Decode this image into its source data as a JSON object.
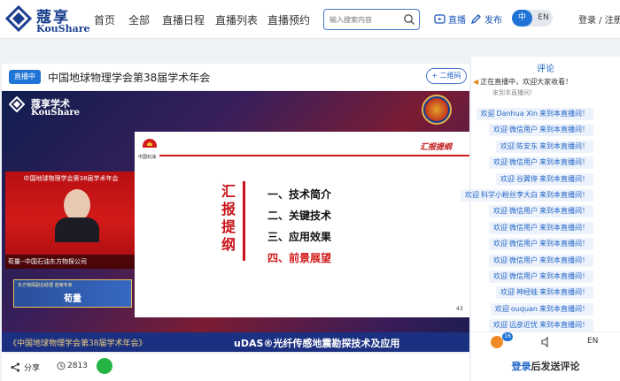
{
  "header": {
    "logo_cn": "蔻享",
    "logo_en": "KouShare",
    "nav": [
      "首页",
      "全部",
      "直播日程",
      "直播列表",
      "直播预约"
    ],
    "search_placeholder": "输入搜索内容",
    "live_btn": "直播",
    "publish_btn": "发布",
    "lang_zh": "中",
    "lang_en": "EN",
    "login": "登录 / 注册"
  },
  "live": {
    "badge": "直播中",
    "title": "中国地球物理学会第38届学术年会",
    "qr_label": "+ 二维码"
  },
  "video": {
    "logo_cn": "蔻享学术",
    "logo_en": "KouShare",
    "cam_header": "中国地球物理学会第38届学术年会",
    "cam_label": "荀量--中国石油东方物探公司",
    "namecard_small": "东方物探副总经理 首席专家",
    "namecard_name": "荀量",
    "slide_brand": "中国石油",
    "slide_section": "汇报提纲",
    "slide_vertical": "汇报提纲",
    "toc": [
      "一、技术简介",
      "二、关键技术",
      "三、应用效果",
      "四、前景展望"
    ],
    "page_no": "43",
    "banner_left": "《中国地球物理学会第38届学术年会》",
    "banner_right": "uDAS®光纤传感地震勘探技术及应用"
  },
  "actions": {
    "share": "分享",
    "views": "2813"
  },
  "comments": {
    "title": "评论",
    "notice": "正在直播中，欢迎大家收看！",
    "partial": "来到本直播间！",
    "items": [
      {
        "prefix": "欢迎",
        "user": "Danhua Xin",
        "suffix": "来到本直播间！"
      },
      {
        "prefix": "欢迎",
        "user": "微信用户",
        "suffix": "来到本直播间！"
      },
      {
        "prefix": "欢迎",
        "user": "陈安东",
        "suffix": "来到本直播间！"
      },
      {
        "prefix": "欢迎",
        "user": "微信用户",
        "suffix": "来到本直播间！"
      },
      {
        "prefix": "欢迎",
        "user": "谷翼停",
        "suffix": "来到本直播间！"
      },
      {
        "prefix": "欢迎",
        "user": "科学小粉丝李大白",
        "suffix": "来到本直播间！"
      },
      {
        "prefix": "欢迎",
        "user": "微信用户",
        "suffix": "来到本直播间！"
      },
      {
        "prefix": "欢迎",
        "user": "微信用户",
        "suffix": "来到本直播间！"
      },
      {
        "prefix": "欢迎",
        "user": "微信用户",
        "suffix": "来到本直播间！"
      },
      {
        "prefix": "欢迎",
        "user": "微信用户",
        "suffix": "来到本直播间！"
      },
      {
        "prefix": "欢迎",
        "user": "微信用户",
        "suffix": "来到本直播间！"
      },
      {
        "prefix": "欢迎",
        "user": "神经蛙",
        "suffix": "来到本直播间！"
      },
      {
        "prefix": "欢迎",
        "user": "ouquan",
        "suffix": "来到本直播间！"
      },
      {
        "prefix": "欢迎",
        "user": "远彦近忧",
        "suffix": "来到本直播间！"
      }
    ],
    "online_badge": "16",
    "lang_toggle": "EN",
    "login_link": "登录",
    "login_suffix": "后发送评论"
  }
}
